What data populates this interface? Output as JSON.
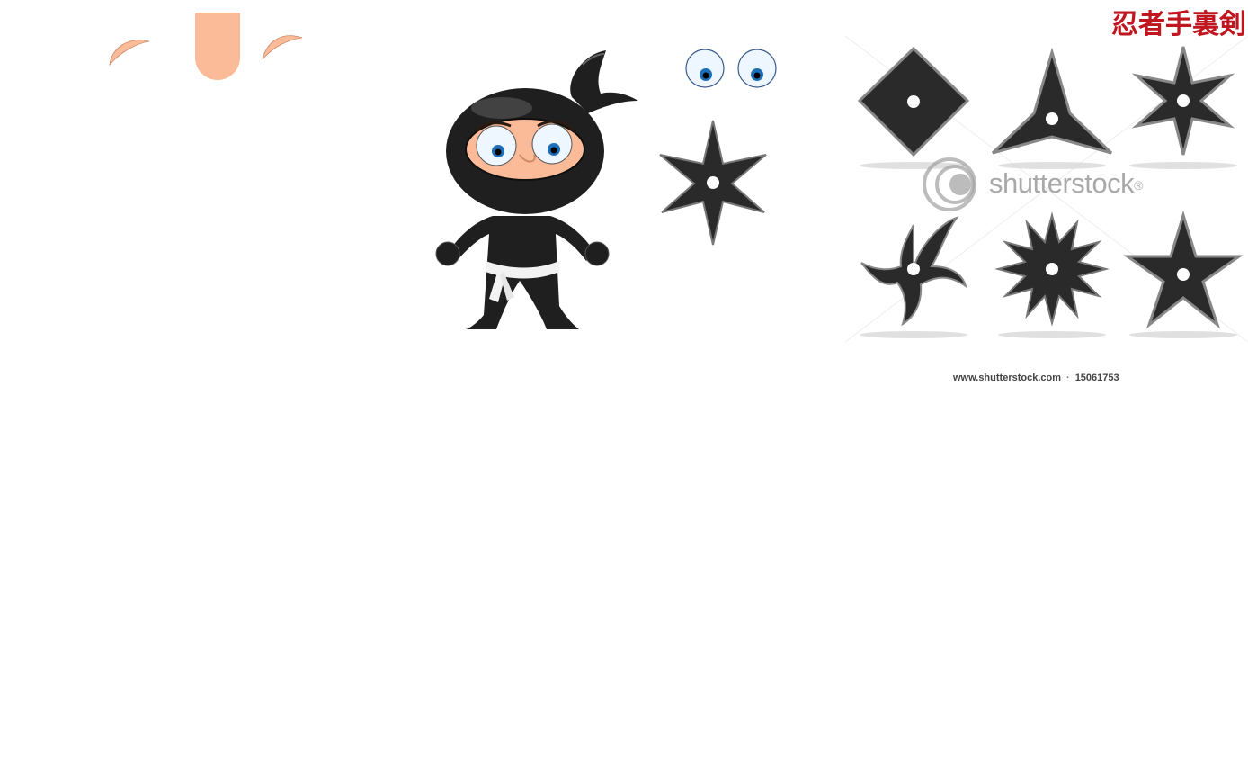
{
  "sheet": {
    "title": "忍者手裏剣"
  },
  "sprites": {
    "skin_parts": [
      "brow-left",
      "nose",
      "brow-right"
    ],
    "character": "ninja",
    "eyes": [
      "eye-left",
      "eye-right"
    ],
    "weapons": [
      "shuriken-six-point",
      "shuriken-four-point",
      "shuriken-three-point",
      "shuriken-six-point-b",
      "shuriken-four-blade-swirl",
      "shuriken-twelve-point",
      "shuriken-five-point"
    ]
  },
  "watermark": {
    "text": "shutterstock",
    "mark": "®",
    "url": "www.shutterstock.com",
    "separator": "·",
    "id": "15061753"
  },
  "colors": {
    "skin": "#fbbb98",
    "ninja_black": "#1f1f1f",
    "title_red": "#c0161f",
    "eye_blue": "#1e6fb8"
  }
}
